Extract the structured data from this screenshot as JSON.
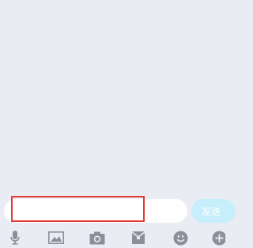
{
  "input": {
    "value": "",
    "placeholder": ""
  },
  "send_button": {
    "label": "发送"
  },
  "toolbar": {
    "items": [
      {
        "icon": "microphone-icon"
      },
      {
        "icon": "image-icon"
      },
      {
        "icon": "camera-icon"
      },
      {
        "icon": "red-packet-icon"
      },
      {
        "icon": "emoji-icon"
      },
      {
        "icon": "plus-icon"
      }
    ]
  },
  "colors": {
    "background": "#eaecf3",
    "icon": "#8a8f99",
    "send_button": "#c7eefb",
    "highlight": "#e53935"
  }
}
